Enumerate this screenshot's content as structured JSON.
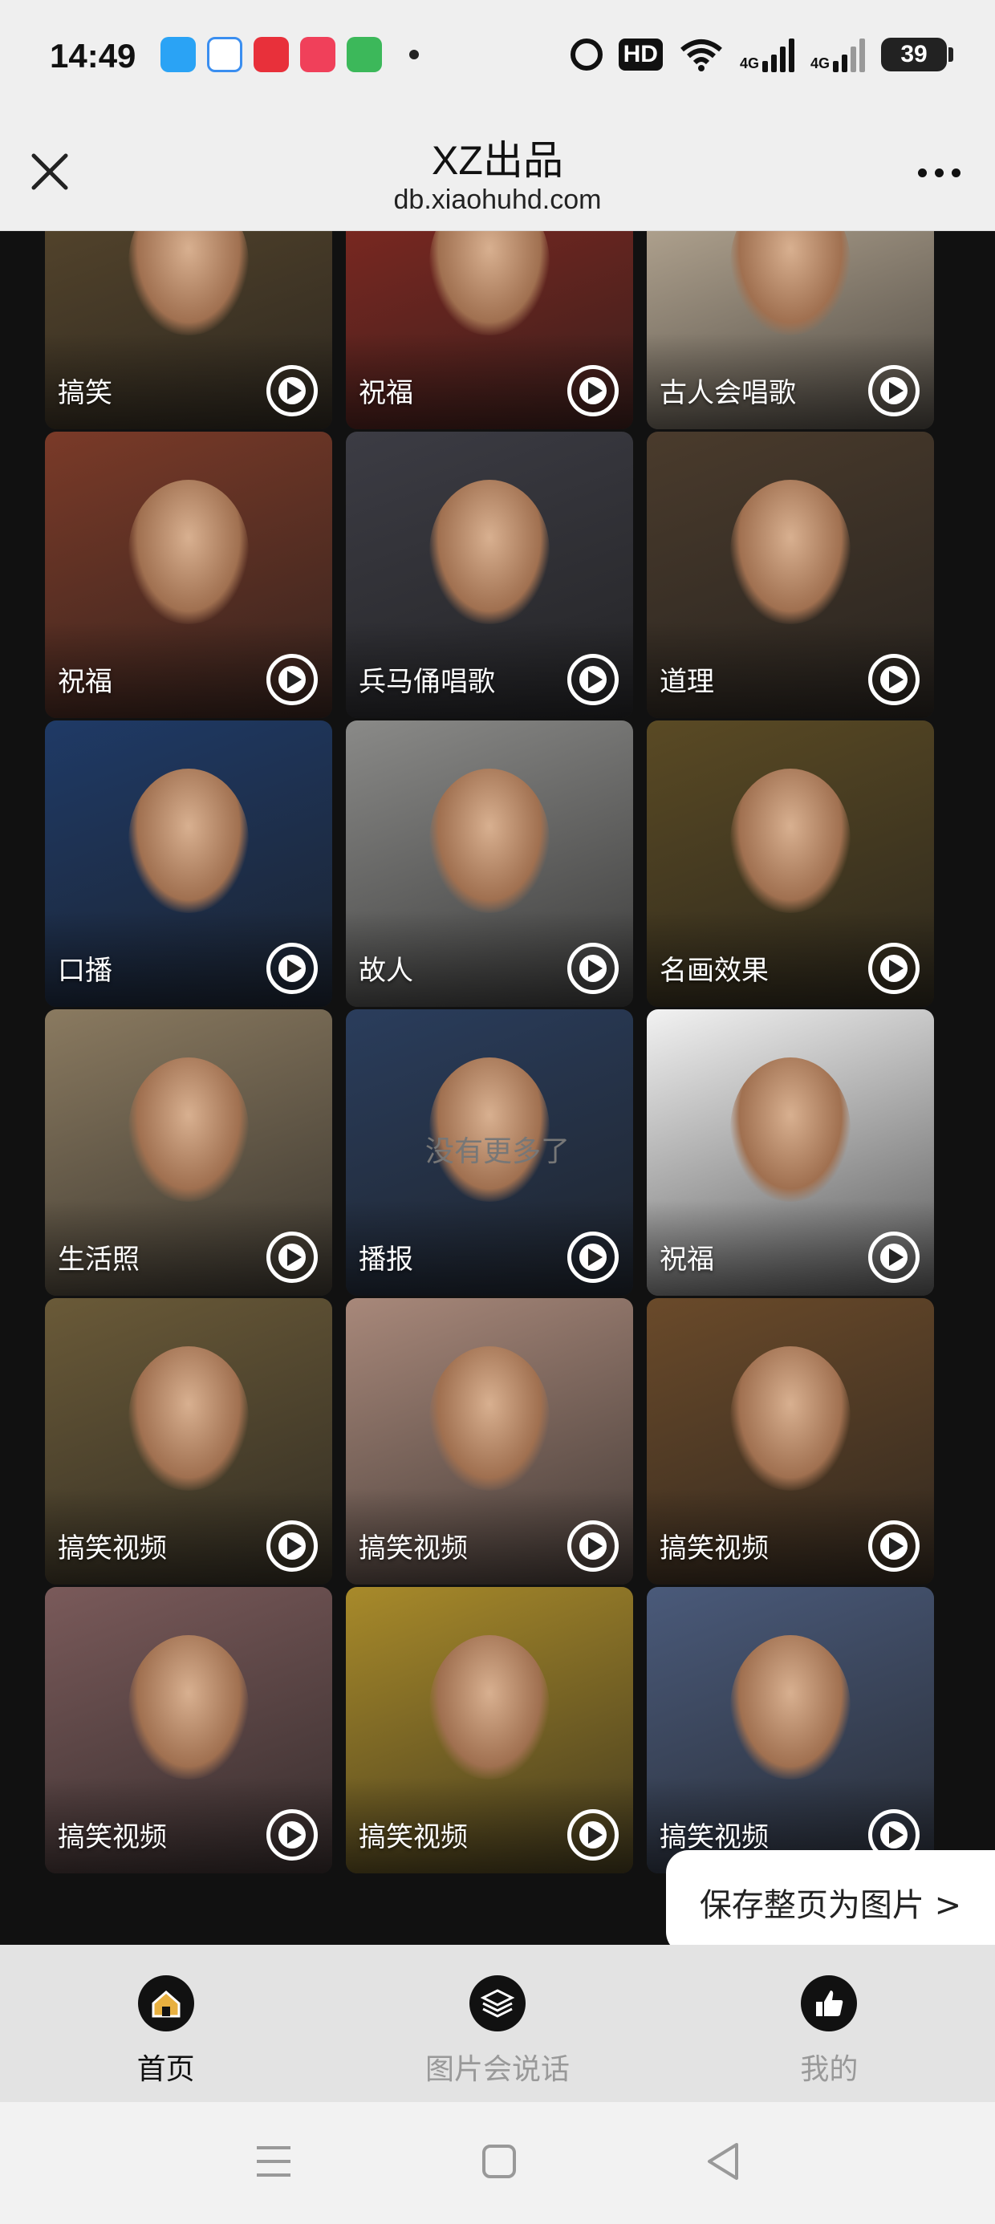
{
  "status_bar": {
    "time": "14:49",
    "hd_label": "HD",
    "network_label": "4G",
    "network_label_2": "4G",
    "battery": "39"
  },
  "header": {
    "title": "XZ出品",
    "url": "db.xiaohuhd.com"
  },
  "tiles": [
    {
      "label": "搞笑",
      "bg": "#5c4a2e"
    },
    {
      "label": "祝福",
      "bg": "#8a2a22"
    },
    {
      "label": "古人会唱歌",
      "bg": "#c9b9a2"
    },
    {
      "label": "祝福",
      "bg": "#7a3a28"
    },
    {
      "label": "兵马俑唱歌",
      "bg": "#3c3c44"
    },
    {
      "label": "道理",
      "bg": "#4a3b2c"
    },
    {
      "label": "口播",
      "bg": "#1f3a66"
    },
    {
      "label": "故人",
      "bg": "#8a8a88"
    },
    {
      "label": "名画效果",
      "bg": "#5a4a24"
    },
    {
      "label": "生活照",
      "bg": "#8a7a60"
    },
    {
      "label": "播报",
      "bg": "#2a3d5c"
    },
    {
      "label": "祝福",
      "bg": "#f2f2f2"
    },
    {
      "label": "搞笑视频",
      "bg": "#6a5a38"
    },
    {
      "label": "搞笑视频",
      "bg": "#a8887a"
    },
    {
      "label": "搞笑视频",
      "bg": "#6a4a2a"
    },
    {
      "label": "搞笑视频",
      "bg": "#7a5a5a"
    },
    {
      "label": "搞笑视频",
      "bg": "#a88a2a"
    },
    {
      "label": "搞笑视频",
      "bg": "#4a5a7a"
    }
  ],
  "no_more_text": "没有更多了",
  "save_button": "保存整页为图片 >",
  "bottom_nav": [
    {
      "label": "首页",
      "icon": "home-icon"
    },
    {
      "label": "图片会说话",
      "icon": "layers-icon"
    },
    {
      "label": "我的",
      "icon": "thumbs-up-icon"
    }
  ]
}
